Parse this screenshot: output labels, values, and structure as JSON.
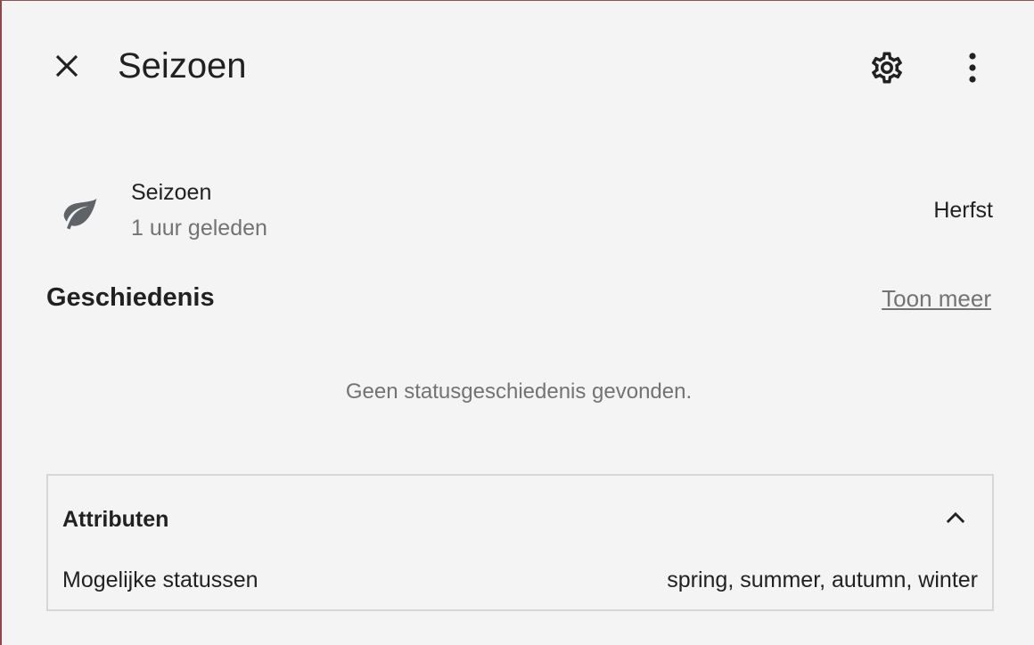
{
  "header": {
    "title": "Seizoen",
    "close_icon": "close-icon",
    "settings_icon": "gear-icon",
    "more_icon": "more-vertical-icon"
  },
  "entity": {
    "icon": "leaf-icon",
    "name": "Seizoen",
    "last_changed": "1 uur geleden",
    "state": "Herfst"
  },
  "history": {
    "title": "Geschiedenis",
    "show_more": "Toon meer",
    "empty_message": "Geen statusgeschiedenis gevonden."
  },
  "attributes": {
    "title": "Attributen",
    "toggle_icon": "chevron-up-icon",
    "items": [
      {
        "label": "Mogelijke statussen",
        "value": "spring, summer, autumn, winter"
      }
    ]
  },
  "colors": {
    "background": "#f4f4f4",
    "text_primary": "#212121",
    "text_secondary": "#737373",
    "icon_color": "#5f6368",
    "border": "#d6d6d6"
  }
}
